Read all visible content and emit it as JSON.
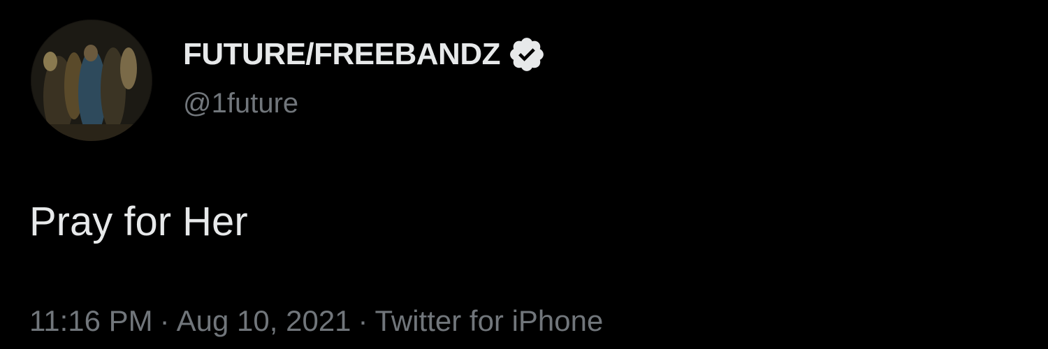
{
  "tweet": {
    "author": {
      "display_name": "FUTURE/FREEBANDZ",
      "handle": "@1future",
      "verified": true,
      "avatar_icon": "profile-photo",
      "verified_icon": "verified-badge-icon"
    },
    "text": "Pray for Her",
    "meta": {
      "time": "11:16 PM",
      "separator": "·",
      "date": "Aug 10, 2021",
      "source": "Twitter for iPhone"
    }
  },
  "colors": {
    "background": "#000000",
    "primary_text": "#e7e9ea",
    "secondary_text": "#71767b",
    "badge": "#e7e9ea"
  }
}
